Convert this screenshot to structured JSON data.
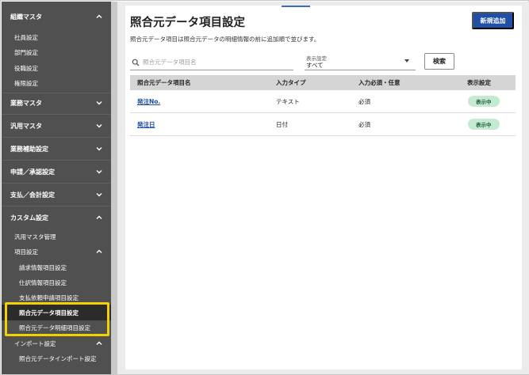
{
  "sidebar": {
    "groups": [
      {
        "label": "組織マスタ",
        "state": "expanded"
      },
      {
        "label": "業務マスタ",
        "state": "collapsed"
      },
      {
        "label": "汎用マスタ",
        "state": "collapsed"
      },
      {
        "label": "業務補助設定",
        "state": "collapsed"
      },
      {
        "label": "申請／承認設定",
        "state": "collapsed"
      },
      {
        "label": "支払／会計設定",
        "state": "collapsed"
      },
      {
        "label": "カスタム設定",
        "state": "expanded"
      }
    ],
    "org_items": [
      "社員設定",
      "部門設定",
      "役職設定",
      "権限設定"
    ],
    "custom_items": {
      "generic_master": "汎用マスタ管理",
      "item_settings": "項目設定",
      "item_children": [
        "請求情報項目設定",
        "仕訳情報項目設定",
        "支払依頼申請項目設定",
        "照合元データ項目設定",
        "照合元データ明細項目設定"
      ],
      "import_settings": "インポート設定",
      "import_children": [
        "照合元データインポート設定"
      ]
    },
    "active_item": "照合元データ項目設定"
  },
  "main": {
    "title": "照合元データ項目設定",
    "description": "照合元データ項目は照合元データの明細情報の前に追加順で並びます。",
    "new_button": "新規追加",
    "search": {
      "placeholder": "照合元データ項目名",
      "value": ""
    },
    "display_filter": {
      "label": "表示設定",
      "value": "すべて"
    },
    "search_button": "検索",
    "table": {
      "columns": [
        "照合元データ項目名",
        "入力タイプ",
        "入力必須・任意",
        "表示設定"
      ],
      "rows": [
        {
          "name": "発注No.",
          "type": "テキスト",
          "required": "必須",
          "display": "表示中"
        },
        {
          "name": "発注日",
          "type": "日付",
          "required": "必須",
          "display": "表示中"
        }
      ]
    }
  },
  "colors": {
    "sidebar_bg": "#505050",
    "accent": "#1f4fa6",
    "badge_bg": "#c6e9d4",
    "highlight": "#f5d000"
  }
}
